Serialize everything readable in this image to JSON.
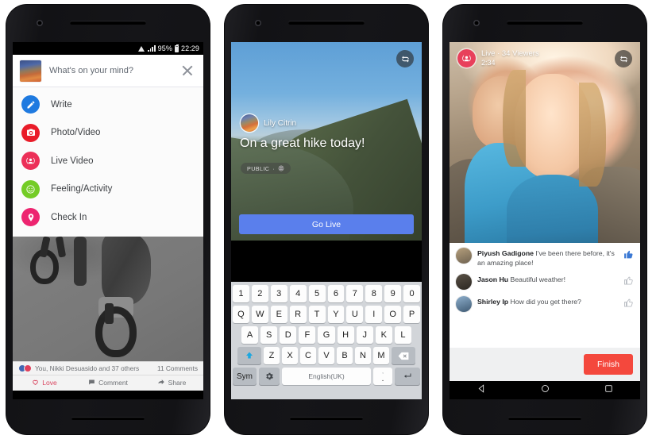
{
  "phones": [
    {
      "id": "phone-composer",
      "statusbar": {
        "battery_pct": "95%",
        "time": "22:29"
      },
      "composer": {
        "placeholder": "What's on your mind?",
        "close_label": "close-icon",
        "menu": [
          {
            "label": "Write",
            "icon": "pencil-icon",
            "color": "#1f7ae0"
          },
          {
            "label": "Photo/Video",
            "icon": "camera-icon",
            "color": "#e91c29"
          },
          {
            "label": "Live Video",
            "icon": "live-icon",
            "color": "#ec3058"
          },
          {
            "label": "Feeling/Activity",
            "icon": "smiley-icon",
            "color": "#74cc26"
          },
          {
            "label": "Check In",
            "icon": "pin-icon",
            "color": "#ed2570"
          }
        ]
      },
      "feed": {
        "reactions_text": "You, Nikki Desuasido and 37 others",
        "comments_text": "11 Comments",
        "actions": [
          {
            "label": "Love",
            "icon": "love-icon"
          },
          {
            "label": "Comment",
            "icon": "comment-icon"
          },
          {
            "label": "Share",
            "icon": "share-icon"
          }
        ]
      }
    },
    {
      "id": "phone-go-live",
      "live_setup": {
        "author": "Lily Citrin",
        "title": "On a great hike today!",
        "privacy": "PUBLIC",
        "privacy_icon": "globe-icon",
        "flip_icon": "flip-camera-icon",
        "go_live_label": "Go Live"
      },
      "keyboard": {
        "row_numbers": [
          "1",
          "2",
          "3",
          "4",
          "5",
          "6",
          "7",
          "8",
          "9",
          "0"
        ],
        "row_top": [
          "Q",
          "W",
          "E",
          "R",
          "T",
          "Y",
          "U",
          "I",
          "O",
          "P"
        ],
        "row_home": [
          "A",
          "S",
          "D",
          "F",
          "G",
          "H",
          "J",
          "K",
          "L"
        ],
        "row_bottom": [
          "Z",
          "X",
          "C",
          "V",
          "B",
          "N",
          "M"
        ],
        "shift_icon": "shift-up-icon",
        "backspace_icon": "backspace-icon",
        "sym_label": "Sym",
        "settings_icon": "gear-icon",
        "space_label": "English(UK)",
        "punct_main": ".",
        "punct_sub": "‚",
        "enter_icon": "enter-icon"
      }
    },
    {
      "id": "phone-broadcasting",
      "broadcast": {
        "live_icon": "live-icon",
        "status": "Live · 34 Viewers",
        "elapsed": "2:34",
        "flip_icon": "flip-camera-icon",
        "comments": [
          {
            "author": "Piyush Gadigone",
            "text": "I've been there before, it's an amazing place!",
            "liked": true,
            "avatar_color": "#9a8264"
          },
          {
            "author": "Jason Hu",
            "text": "Beautiful weather!",
            "liked": false,
            "avatar_color": "#3e3a35"
          },
          {
            "author": "Shirley Ip",
            "text": "How did you get there?",
            "liked": false,
            "avatar_color": "#5c7390"
          }
        ],
        "finish_label": "Finish"
      },
      "navbar": [
        {
          "name": "back-nav-button",
          "icon": "triangle-back-icon"
        },
        {
          "name": "home-nav-button",
          "icon": "circle-home-icon"
        },
        {
          "name": "recents-nav-button",
          "icon": "square-recents-icon"
        }
      ]
    }
  ],
  "theme": {
    "fb_blue": "#1f7ae0",
    "go_live_blue": "#5a7fec",
    "finish_red": "#f4483d",
    "live_pink": "#e8405b"
  }
}
